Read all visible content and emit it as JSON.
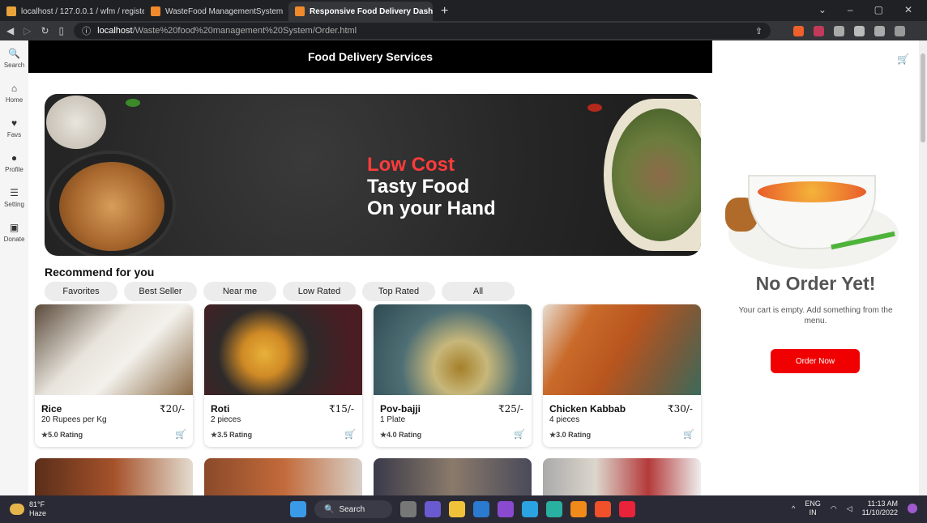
{
  "browser": {
    "tabs": [
      {
        "label": "localhost / 127.0.0.1 / wfm / register |",
        "color": "#e8a33a"
      },
      {
        "label": "WasteFood ManagementSystem",
        "color": "#f08a2a"
      },
      {
        "label": "Responsive Food Delivery Dashbo",
        "color": "#f08a2a",
        "close": "✕"
      }
    ],
    "new_tab": "+",
    "url_host": "localhost",
    "url_path": "/Waste%20food%20management%20System/Order.html"
  },
  "sidebar": {
    "items": [
      {
        "label": "Search",
        "icon": "🔍"
      },
      {
        "label": "Home",
        "icon": "⌂"
      },
      {
        "label": "Favs",
        "icon": "♥"
      },
      {
        "label": "Profile",
        "icon": "●"
      },
      {
        "label": "Setting",
        "icon": "☰"
      },
      {
        "label": "Donate",
        "icon": "▣"
      }
    ]
  },
  "header": {
    "title": "Food Delivery Services"
  },
  "banner": {
    "line1": "Low Cost",
    "line2": "Tasty Food",
    "line3": "On your Hand"
  },
  "recommend": {
    "title": "Recommend for you",
    "chips": [
      "Favorites",
      "Best Seller",
      "Near me",
      "Low Rated",
      "Top Rated",
      "All"
    ]
  },
  "items": [
    {
      "name": "Rice",
      "price": "₹20/-",
      "desc": "20 Rupees per Kg",
      "rating": "★5.0 Rating",
      "img": "#c9b59a"
    },
    {
      "name": "Roti",
      "price": "₹15/-",
      "desc": "2 pieces",
      "rating": "★3.5 Rating",
      "img": "#6b2b2b"
    },
    {
      "name": "Pov-bajji",
      "price": "₹25/-",
      "desc": "1 Plate",
      "rating": "★4.0 Rating",
      "img": "#9fb2b4"
    },
    {
      "name": "Chicken Kabbab",
      "price": "₹30/-",
      "desc": "4 pieces",
      "rating": "★3.0 Rating",
      "img": "#c3793a"
    }
  ],
  "cart": {
    "title": "No Order Yet!",
    "message": "Your cart is empty. Add something from the menu.",
    "button": "Order Now"
  },
  "taskbar": {
    "temp": "81°F",
    "weather": "Haze",
    "search": "Search",
    "lang1": "ENG",
    "lang2": "IN",
    "time": "11:13 AM",
    "date": "11/10/2022"
  }
}
